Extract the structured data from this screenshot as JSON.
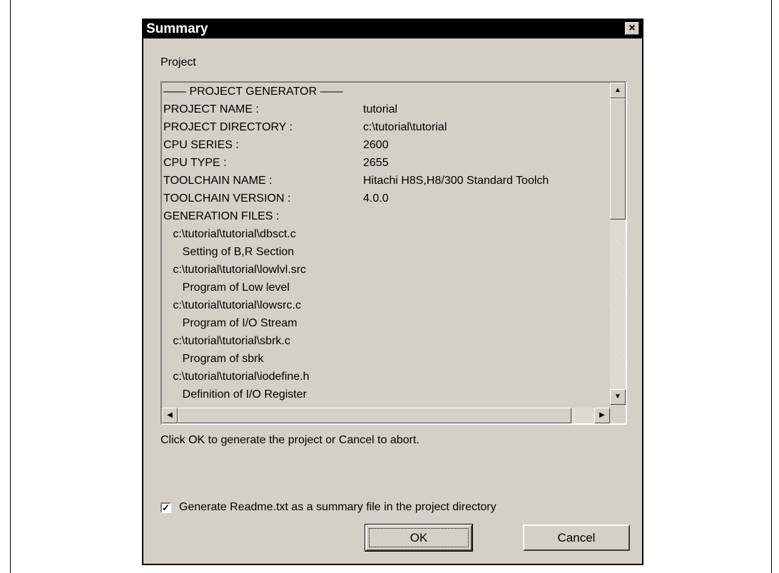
{
  "dialog": {
    "title": "Summary",
    "close_glyph": "×",
    "project_label": "Project",
    "summary_rows": [
      {
        "label": "—— PROJECT GENERATOR ——",
        "value": ""
      },
      {
        "label": "PROJECT NAME :",
        "value": "tutorial"
      },
      {
        "label": "PROJECT DIRECTORY :",
        "value": "c:\\tutorial\\tutorial"
      },
      {
        "label": "CPU SERIES :",
        "value": "2600"
      },
      {
        "label": "CPU TYPE :",
        "value": "2655"
      },
      {
        "label": "TOOLCHAIN NAME :",
        "value": "Hitachi H8S,H8/300 Standard Toolch"
      },
      {
        "label": "TOOLCHAIN VERSION :",
        "value": "4.0.0"
      },
      {
        "label": "GENERATION FILES :",
        "value": ""
      },
      {
        "label": "   c:\\tutorial\\tutorial\\dbsct.c",
        "value": ""
      },
      {
        "label": "      Setting of B,R Section",
        "value": ""
      },
      {
        "label": "   c:\\tutorial\\tutorial\\lowlvl.src",
        "value": ""
      },
      {
        "label": "      Program of Low level",
        "value": ""
      },
      {
        "label": "   c:\\tutorial\\tutorial\\lowsrc.c",
        "value": ""
      },
      {
        "label": "      Program of I/O Stream",
        "value": ""
      },
      {
        "label": "   c:\\tutorial\\tutorial\\sbrk.c",
        "value": ""
      },
      {
        "label": "      Program of sbrk",
        "value": ""
      },
      {
        "label": "   c:\\tutorial\\tutorial\\iodefine.h",
        "value": ""
      },
      {
        "label": "      Definition of I/O Register",
        "value": ""
      }
    ],
    "hint": "Click OK to generate the project or Cancel to abort.",
    "checkbox": {
      "checked": true,
      "label": "Generate Readme.txt as a summary file in the project directory"
    },
    "ok_label": "OK",
    "cancel_label": "Cancel"
  },
  "scroll_icons": {
    "up": "▲",
    "down": "▼",
    "left": "◀",
    "right": "▶"
  }
}
